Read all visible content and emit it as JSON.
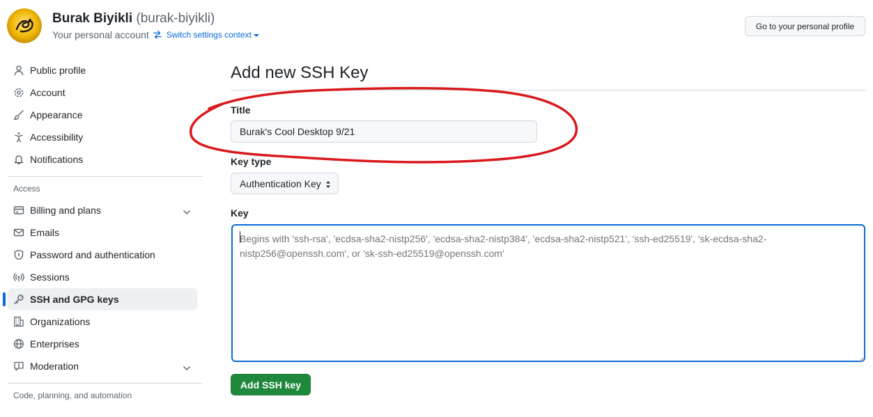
{
  "header": {
    "display_name": "Burak Biyikli",
    "username": "(burak-biyikli)",
    "account_type": "Your personal account",
    "switch_context": "Switch settings context",
    "profile_button": "Go to your personal profile"
  },
  "sidebar": {
    "items": [
      {
        "label": "Public profile",
        "icon": "person-icon"
      },
      {
        "label": "Account",
        "icon": "gear-icon"
      },
      {
        "label": "Appearance",
        "icon": "paintbrush-icon"
      },
      {
        "label": "Accessibility",
        "icon": "accessibility-icon"
      },
      {
        "label": "Notifications",
        "icon": "bell-icon"
      }
    ],
    "access_heading": "Access",
    "access_items": [
      {
        "label": "Billing and plans",
        "icon": "credit-card-icon"
      },
      {
        "label": "Emails",
        "icon": "mail-icon"
      },
      {
        "label": "Password and authentication",
        "icon": "shield-lock-icon"
      },
      {
        "label": "Sessions",
        "icon": "broadcast-icon"
      },
      {
        "label": "SSH and GPG keys",
        "icon": "key-icon",
        "active": true
      },
      {
        "label": "Organizations",
        "icon": "organization-icon"
      },
      {
        "label": "Enterprises",
        "icon": "globe-icon"
      },
      {
        "label": "Moderation",
        "icon": "report-icon"
      }
    ],
    "code_heading": "Code, planning, and automation"
  },
  "main": {
    "title": "Add new SSH Key",
    "title_label": "Title",
    "title_value": "Burak's Cool Desktop 9/21",
    "key_type_label": "Key type",
    "key_type_value": "Authentication Key",
    "key_label": "Key",
    "key_placeholder": "Begins with 'ssh-rsa', 'ecdsa-sha2-nistp256', 'ecdsa-sha2-nistp384', 'ecdsa-sha2-nistp521', 'ssh-ed25519', 'sk-ecdsa-sha2-nistp256@openssh.com', or 'sk-ssh-ed25519@openssh.com'",
    "submit_label": "Add SSH key"
  },
  "colors": {
    "accent": "#0969da",
    "primary_button": "#1f883d",
    "annotation": "#d9191c"
  }
}
